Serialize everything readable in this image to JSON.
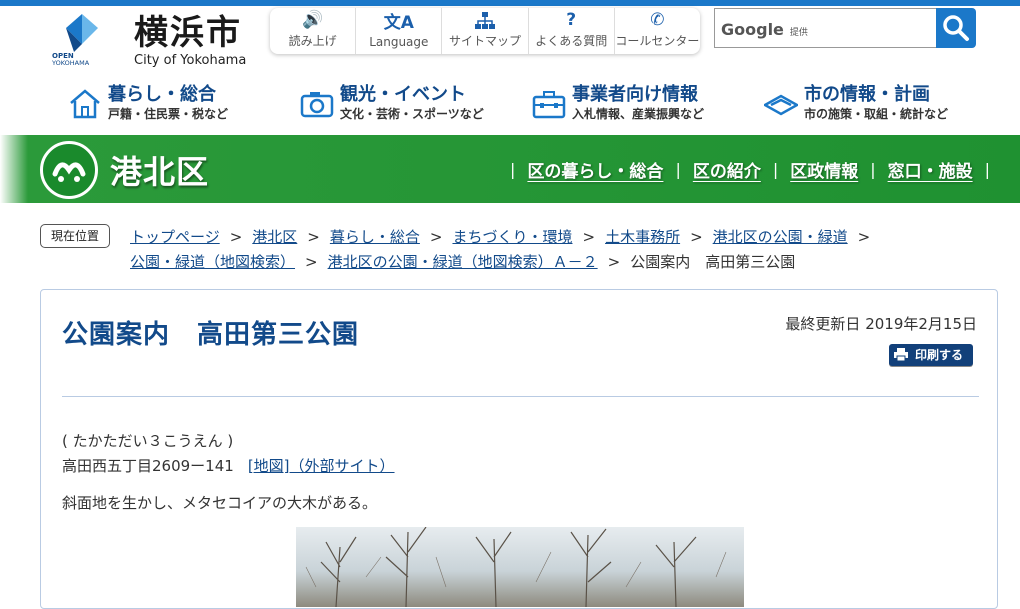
{
  "site": {
    "logo_text": "横浜市",
    "logo_sub": "City of Yokohama",
    "logo_mark_text": "OPEN YOKOHAMA"
  },
  "util_nav": [
    {
      "label": "読み上げ",
      "icon": "speaker-icon"
    },
    {
      "label": "Language",
      "icon": "language-icon"
    },
    {
      "label": "サイトマップ",
      "icon": "sitemap-icon"
    },
    {
      "label": "よくある質問",
      "icon": "question-icon"
    },
    {
      "label": "コールセンター",
      "icon": "phone-icon"
    }
  ],
  "search": {
    "brand": "Google",
    "brand_suffix": "提供",
    "button_icon": "search-icon"
  },
  "global_nav": [
    {
      "title": "暮らし・総合",
      "sub": "戸籍・住民票・税など",
      "icon": "house-icon"
    },
    {
      "title": "観光・イベント",
      "sub": "文化・芸術・スポーツなど",
      "icon": "camera-icon"
    },
    {
      "title": "事業者向け情報",
      "sub": "入札情報、産業振興など",
      "icon": "briefcase-icon"
    },
    {
      "title": "市の情報・計画",
      "sub": "市の施策・取組・統計など",
      "icon": "city-emblem-icon"
    }
  ],
  "ward": {
    "name": "港北区",
    "links": [
      "区の暮らし・総合",
      "区の紹介",
      "区政情報",
      "窓口・施設"
    ]
  },
  "breadcrumb": {
    "label": "現在位置",
    "items": [
      "トップページ",
      "港北区",
      "暮らし・総合",
      "まちづくり・環境",
      "土木事務所",
      "港北区の公園・緑道",
      "公園・緑道（地図検索）",
      "港北区の公園・緑道（地図検索）Ａ－２"
    ],
    "current": "公園案内　高田第三公園",
    "separator": ">"
  },
  "article": {
    "title": "公園案内　高田第三公園",
    "updated": "最終更新日 2019年2月15日",
    "print_label": "印刷する",
    "reading": "( たかただい３こうえん )",
    "address": "高田西五丁目2609ー141",
    "map_link": "[地図]（外部サイト）",
    "description": "斜面地を生かし、メタセコイアの大木がある。"
  },
  "colors": {
    "brand_blue": "#1b78c9",
    "link_blue": "#124a8a",
    "ward_green": "#1f9131"
  }
}
